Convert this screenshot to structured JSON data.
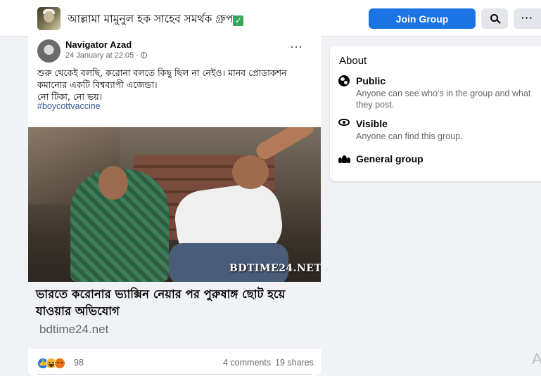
{
  "header": {
    "group_name": "আল্লামা মামুনুল হক সাহেব সমর্থক গ্রুপ",
    "verified_mark": "✓",
    "join_label": "Join Group",
    "more_label": "···"
  },
  "post": {
    "author": "Navigator Azad",
    "date": "24 January at 22:05 ·",
    "more_label": "···",
    "text_lines": [
      "শুরু থেকেই বলছি, করোনা বলতে কিছু ছিল না নেইও। মানব প্রোডাকশন",
      "কমানোর একটি বিশ্বব্যাপী এজেন্ডা।",
      "নো টিকা,  নো ভয়।"
    ],
    "hashtag": "#boycottvaccine",
    "image_watermark": "BDTIME24.NET",
    "link_title": "ভারতে করোনার ভ্যাক্সিন নেয়ার পর পুরুষাঙ্গ ছোট হয়ে যাওয়ার অভিযোগ",
    "link_domain": "bdtime24.net",
    "reaction_count": "98",
    "comments": "4 comments",
    "shares": "19 shares"
  },
  "about": {
    "title": "About",
    "public_title": "Public",
    "public_desc": "Anyone can see who's in the group and what they post.",
    "visible_title": "Visible",
    "visible_desc": "Anyone can find this group.",
    "general_title": "General group"
  },
  "edge_text": "A",
  "colors": {
    "accent": "#1b74e4",
    "background": "#f0f2f5",
    "secondary_text": "#65676b",
    "link": "#385898"
  },
  "icons": [
    "search-icon",
    "more-icon",
    "globe-icon",
    "eye-icon",
    "group-icon",
    "like-reaction-icon",
    "haha-reaction-icon",
    "angry-reaction-icon"
  ]
}
